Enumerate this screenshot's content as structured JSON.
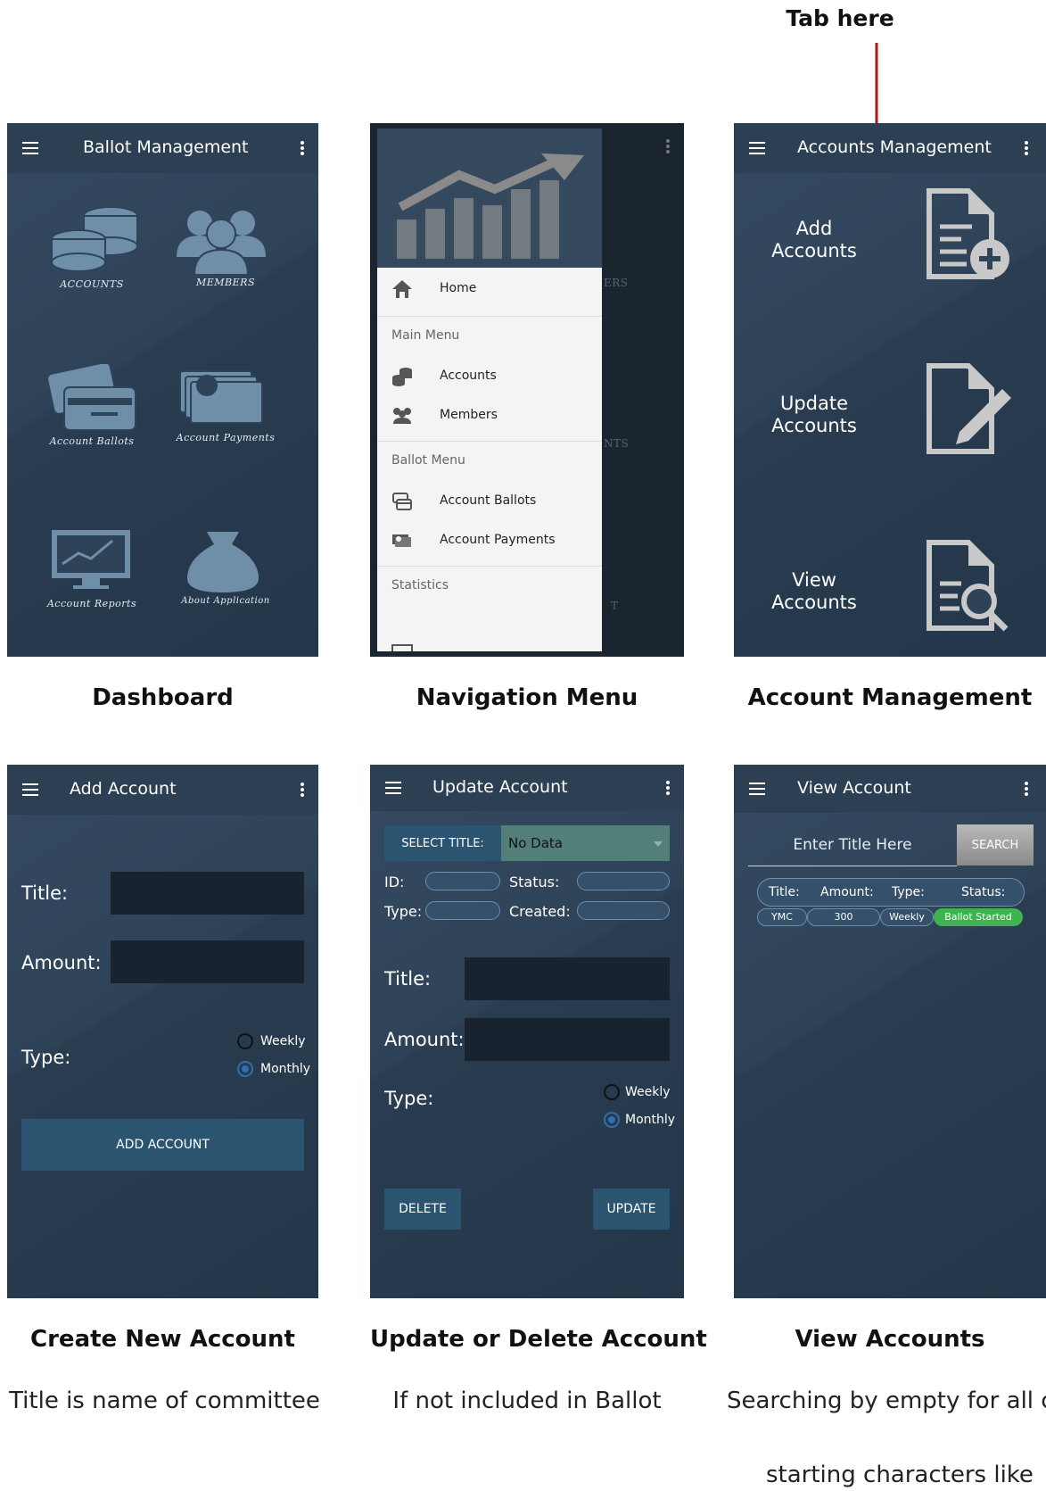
{
  "annotation": {
    "tab_here": "Tab here"
  },
  "dashboard": {
    "title": "Ballot Management",
    "tiles": [
      "ACCOUNTS",
      "MEMBERS",
      "Account Ballots",
      "Account Payments",
      "Account Reports",
      "About Application"
    ],
    "caption": "Dashboard"
  },
  "nav": {
    "items": {
      "home": "Home",
      "accounts": "Accounts",
      "members": "Members",
      "account_ballots": "Account Ballots",
      "account_payments": "Account Payments"
    },
    "sections": {
      "main": "Main Menu",
      "ballot": "Ballot Menu",
      "statistics": "Statistics"
    },
    "caption": "Navigation Menu",
    "bg_fragments": [
      "ERS",
      "NTS",
      "T"
    ]
  },
  "account_mgmt": {
    "title": "Accounts Management",
    "add": [
      "Add",
      "Accounts"
    ],
    "update": [
      "Update",
      "Accounts"
    ],
    "view": [
      "View",
      "Accounts"
    ],
    "caption": "Account Management"
  },
  "add_account": {
    "title": "Add Account",
    "title_label": "Title:",
    "amount_label": "Amount:",
    "type_label": "Type:",
    "weekly": "Weekly",
    "monthly": "Monthly",
    "selected_type": "Monthly",
    "button": "ADD ACCOUNT",
    "caption": "Create New Account",
    "subcaption": "Title is name of committee"
  },
  "update_account": {
    "title": "Update Account",
    "select_title_label": "SELECT TITLE:",
    "select_value": "No Data",
    "id_label": "ID:",
    "status_label": "Status:",
    "type_short_label": "Type:",
    "created_label": "Created:",
    "title_label": "Title:",
    "amount_label": "Amount:",
    "type_label": "Type:",
    "weekly": "Weekly",
    "monthly": "Monthly",
    "selected_type": "Monthly",
    "delete": "DELETE",
    "update": "UPDATE",
    "caption": "Update or Delete Account",
    "subcaption": "If not included in Ballot"
  },
  "view_account": {
    "title": "View Account",
    "search_placeholder": "Enter Title Here",
    "search_button": "SEARCH",
    "headers": [
      "Title:",
      "Amount:",
      "Type:",
      "Status:"
    ],
    "row": [
      "YMC",
      "300",
      "Weekly",
      "Ballot Started"
    ],
    "caption": "View Accounts",
    "subcaption": "Searching by empty for all c",
    "subcaption2": "starting characters like"
  },
  "colors": {
    "accent": "#2b5470",
    "status_green": "#3fb34f",
    "arrow": "#b0121b"
  }
}
